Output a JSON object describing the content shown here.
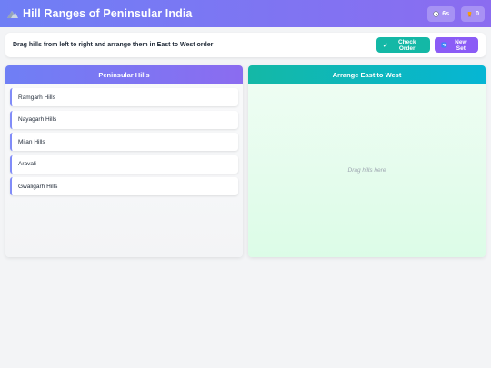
{
  "header": {
    "title": "Hill Ranges of Peninsular India",
    "timer": "6s",
    "score": "0"
  },
  "toolbar": {
    "instructions": "Drag hills from left to right and arrange them in East to West order",
    "check_label": "Check Order",
    "new_set_label": "New Set"
  },
  "source_panel": {
    "title": "Peninsular Hills",
    "items": [
      {
        "label": "Ramgarh Hills"
      },
      {
        "label": "Nayagarh Hills"
      },
      {
        "label": "Milan Hills"
      },
      {
        "label": "Aravali"
      },
      {
        "label": "Gwaligarh Hills"
      }
    ]
  },
  "target_panel": {
    "title": "Arrange East to West",
    "placeholder": "Drag hills here"
  },
  "colors": {
    "header_gradient": [
      "#6f7ff5",
      "#8b6cf0"
    ],
    "check_button": "#14b8a6",
    "new_set_button": "#8b5cf6",
    "target_header": [
      "#14b8a6",
      "#06b6d4"
    ]
  }
}
